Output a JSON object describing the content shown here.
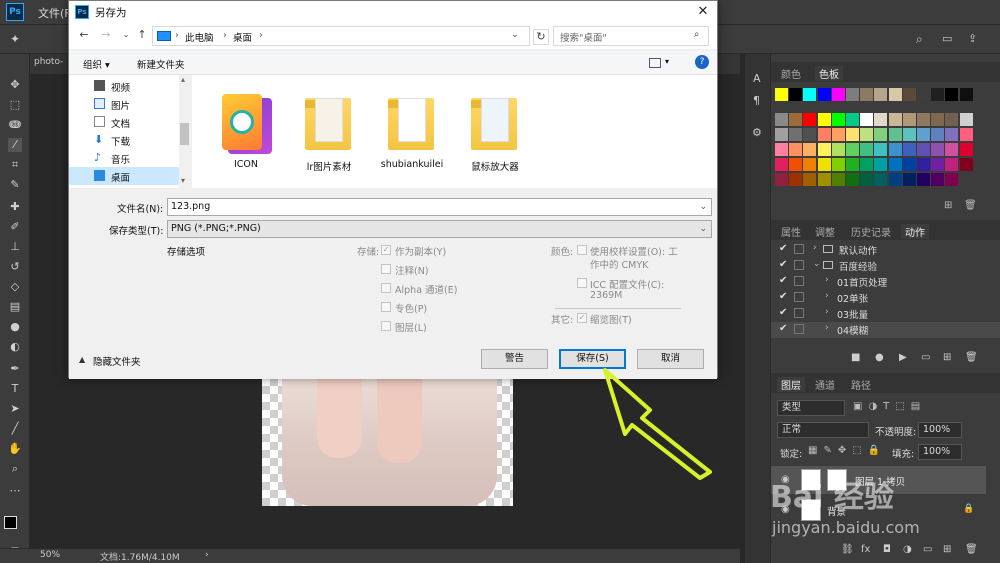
{
  "photoshop": {
    "menubar": {
      "logo": "Ps",
      "first_menu": "文件(F)"
    },
    "doc_tab": "photo-",
    "status": {
      "zoom": "50%",
      "doc_info": "文档:1.76M/4.10M"
    },
    "tools": [
      "move-icon",
      "marquee-icon",
      "lasso-icon",
      "magic-wand-icon",
      "crop-icon",
      "eyedropper-icon",
      "heal-icon",
      "brush-icon",
      "stamp-icon",
      "history-brush-icon",
      "eraser-icon",
      "gradient-icon",
      "blur-icon",
      "dodge-icon",
      "pen-icon",
      "type-icon",
      "path-select-icon",
      "shape-icon",
      "hand-icon",
      "zoom-icon",
      "more-icon"
    ]
  },
  "swatches_panel": {
    "tabs": [
      "颜色",
      "色板"
    ],
    "active_tab": "色板",
    "colors": [
      "#ffff00",
      "#000000",
      "#00ffff",
      "#0000ff",
      "#ff00ff",
      "#7d7d7d",
      "#8c7a63",
      "#b5a58e",
      "#d9c8a8",
      "#5a4a3a",
      "#3d3d3d",
      "#202020",
      "#000000",
      "#0f0f0f",
      "#8a8a8a",
      "#9c6b3a",
      "#ff0000",
      "#ffff00",
      "#00ff00",
      "#00cc88",
      "#ffffff",
      "#e0d8c8",
      "#c8b898",
      "#b09878",
      "#907860",
      "#806850",
      "#706050",
      "#d0d0d0",
      "#a0a0a0",
      "#707070",
      "#505050",
      "#ff8060",
      "#ffa060",
      "#ffe070",
      "#c0e080",
      "#80d080",
      "#60c090",
      "#60c0c0",
      "#60a0d0",
      "#6080c0",
      "#8070c0",
      "#ff6080",
      "#ff80a0",
      "#ff9060",
      "#ffb060",
      "#fff060",
      "#b0e060",
      "#60d060",
      "#40c080",
      "#40c0c0",
      "#4090d0",
      "#4060c0",
      "#6050b0",
      "#9050b0",
      "#d050a0",
      "#e00030",
      "#e02060",
      "#f05000",
      "#f08000",
      "#f0e000",
      "#80d000",
      "#20b020",
      "#00a060",
      "#00a0a0",
      "#0070c0",
      "#0040a0",
      "#3020a0",
      "#7020a0",
      "#c02080",
      "#800020",
      "#902040",
      "#a03000",
      "#a06000",
      "#a09000",
      "#508000",
      "#107010",
      "#006040",
      "#006060",
      "#004080",
      "#002060",
      "#200060",
      "#500060",
      "#800050"
    ]
  },
  "actions_panel": {
    "tabs": [
      "属性",
      "调整",
      "历史记录",
      "动作"
    ],
    "active_tab": "动作",
    "items": [
      {
        "label": "默认动作",
        "level": 0,
        "folder": true,
        "expanded": false
      },
      {
        "label": "百度经验",
        "level": 0,
        "folder": true,
        "expanded": true
      },
      {
        "label": "01首页处理",
        "level": 1
      },
      {
        "label": "02单张",
        "level": 1
      },
      {
        "label": "03批量",
        "level": 1
      },
      {
        "label": "04模糊",
        "level": 1
      }
    ]
  },
  "layers_panel": {
    "tabs": [
      "图层",
      "通道",
      "路径"
    ],
    "active_tab": "图层",
    "filter": "类型",
    "blend_mode": "正常",
    "opacity_label": "不透明度:",
    "opacity": "100%",
    "lock_label": "锁定:",
    "fill_label": "填充:",
    "fill": "100%",
    "layers": [
      {
        "name": "图层 1 拷贝"
      },
      {
        "name": "背景"
      }
    ]
  },
  "dialog": {
    "title": "另存为",
    "breadcrumb": [
      "此电脑",
      "桌面"
    ],
    "search_placeholder": "搜索\"桌面\"",
    "toolbar": {
      "organize": "组织 ▾",
      "new_folder": "新建文件夹"
    },
    "nav_items": [
      {
        "label": "视频",
        "icon": "video-icon"
      },
      {
        "label": "图片",
        "icon": "pictures-icon"
      },
      {
        "label": "文档",
        "icon": "documents-icon"
      },
      {
        "label": "下载",
        "icon": "downloads-icon"
      },
      {
        "label": "音乐",
        "icon": "music-icon"
      },
      {
        "label": "桌面",
        "icon": "desktop-icon",
        "selected": true
      }
    ],
    "files": [
      {
        "name": "ICON"
      },
      {
        "name": "lr图片素材"
      },
      {
        "name": "shubiankuilei"
      },
      {
        "name": "鼠标放大器"
      }
    ],
    "filename_label": "文件名(N):",
    "filename_value": "123.png",
    "filetype_label": "保存类型(T):",
    "filetype_value": "PNG (*.PNG;*.PNG)",
    "save_options_label": "存储选项",
    "save_label": "存储:",
    "save_opts": [
      {
        "label": "作为副本(Y)",
        "checked": true
      },
      {
        "label": "注释(N)",
        "checked": false
      },
      {
        "label": "Alpha 通道(E)",
        "checked": false
      },
      {
        "label": "专色(P)",
        "checked": false
      },
      {
        "label": "图层(L)",
        "checked": false
      }
    ],
    "color_label": "颜色:",
    "color_opt1_line1": "使用校样设置(O): 工",
    "color_opt1_line2": "作中的 CMYK",
    "color_opt2_line1": "ICC 配置文件(C):",
    "color_opt2_line2": "2369M",
    "other_label": "其它:",
    "thumbnail_label": "缩览图(T)",
    "hide_folders": "隐藏文件夹",
    "buttons": {
      "warning": "警告",
      "save": "保存(S)",
      "cancel": "取消"
    }
  },
  "watermark": {
    "text": "Bai 经验",
    "url": "jingyan.baidu.com"
  }
}
